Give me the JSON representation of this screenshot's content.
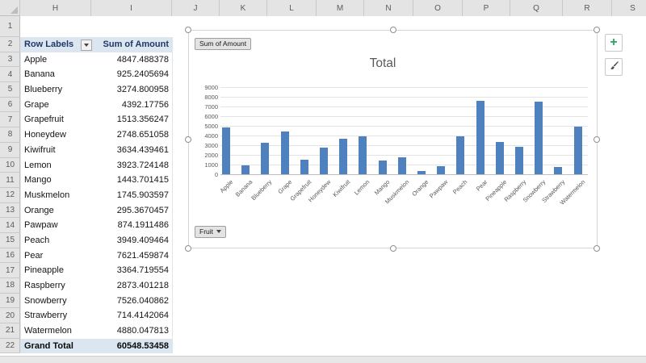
{
  "spreadsheet": {
    "column_letters": [
      "H",
      "I",
      "J",
      "K",
      "L",
      "M",
      "N",
      "O",
      "P",
      "Q",
      "R",
      "S"
    ],
    "row_numbers": [
      "1",
      "2",
      "3",
      "4",
      "5",
      "6",
      "7",
      "8",
      "9",
      "10",
      "11",
      "12",
      "13",
      "14",
      "15",
      "16",
      "17",
      "18",
      "19",
      "20",
      "21",
      "22"
    ]
  },
  "pivot_table": {
    "header": {
      "row_labels": "Row Labels",
      "value_label": "Sum of Amount"
    },
    "rows": [
      {
        "label": "Apple",
        "value": "4847.488378"
      },
      {
        "label": "Banana",
        "value": "925.2405694"
      },
      {
        "label": "Blueberry",
        "value": "3274.800958"
      },
      {
        "label": "Grape",
        "value": "4392.17756"
      },
      {
        "label": "Grapefruit",
        "value": "1513.356247"
      },
      {
        "label": "Honeydew",
        "value": "2748.651058"
      },
      {
        "label": "Kiwifruit",
        "value": "3634.439461"
      },
      {
        "label": "Lemon",
        "value": "3923.724148"
      },
      {
        "label": "Mango",
        "value": "1443.701415"
      },
      {
        "label": "Muskmelon",
        "value": "1745.903597"
      },
      {
        "label": "Orange",
        "value": "295.3670457"
      },
      {
        "label": "Pawpaw",
        "value": "874.1911486"
      },
      {
        "label": "Peach",
        "value": "3949.409464"
      },
      {
        "label": "Pear",
        "value": "7621.459874"
      },
      {
        "label": "Pineapple",
        "value": "3364.719554"
      },
      {
        "label": "Raspberry",
        "value": "2873.401218"
      },
      {
        "label": "Snowberry",
        "value": "7526.040862"
      },
      {
        "label": "Strawberry",
        "value": "714.4142064"
      },
      {
        "label": "Watermelon",
        "value": "4880.047813"
      }
    ],
    "grand_total": {
      "label": "Grand Total",
      "value": "60548.53458"
    },
    "filter_icon": "chevron-down"
  },
  "chart": {
    "value_field_button": "Sum of Amount",
    "axis_field_button": "Fruit",
    "axis_field_icon": "chevron-down",
    "elements_button_icon": "plus",
    "styles_button_icon": "paintbrush"
  },
  "chart_data": {
    "type": "bar",
    "title": "Total",
    "categories": [
      "Apple",
      "Banana",
      "Blueberry",
      "Grape",
      "Grapefruit",
      "Honeydew",
      "Kiwifruit",
      "Lemon",
      "Mango",
      "Muskmelon",
      "Orange",
      "Pawpaw",
      "Peach",
      "Pear",
      "Pineapple",
      "Raspberry",
      "Snowberry",
      "Strawberry",
      "Watermelon"
    ],
    "values": [
      4847.488378,
      925.2405694,
      3274.800958,
      4392.17756,
      1513.356247,
      2748.651058,
      3634.439461,
      3923.724148,
      1443.701415,
      1745.903597,
      295.3670457,
      874.1911486,
      3949.409464,
      7621.459874,
      3364.719554,
      2873.401218,
      7526.040862,
      714.4142064,
      4880.047813
    ],
    "xlabel": "",
    "ylabel": "",
    "ylim": [
      0,
      9000
    ],
    "ytick_step": 1000,
    "grid": true,
    "legend_position": "none",
    "bar_color": "#4E81BD"
  },
  "colors": {
    "bar": "#4E81BD",
    "pivot_header_bg": "#DCE6F1",
    "pivot_header_text": "#1F3864",
    "plus_icon_green": "#28A366",
    "gridline": "#E3E3E3"
  },
  "plus_glyph": "+"
}
